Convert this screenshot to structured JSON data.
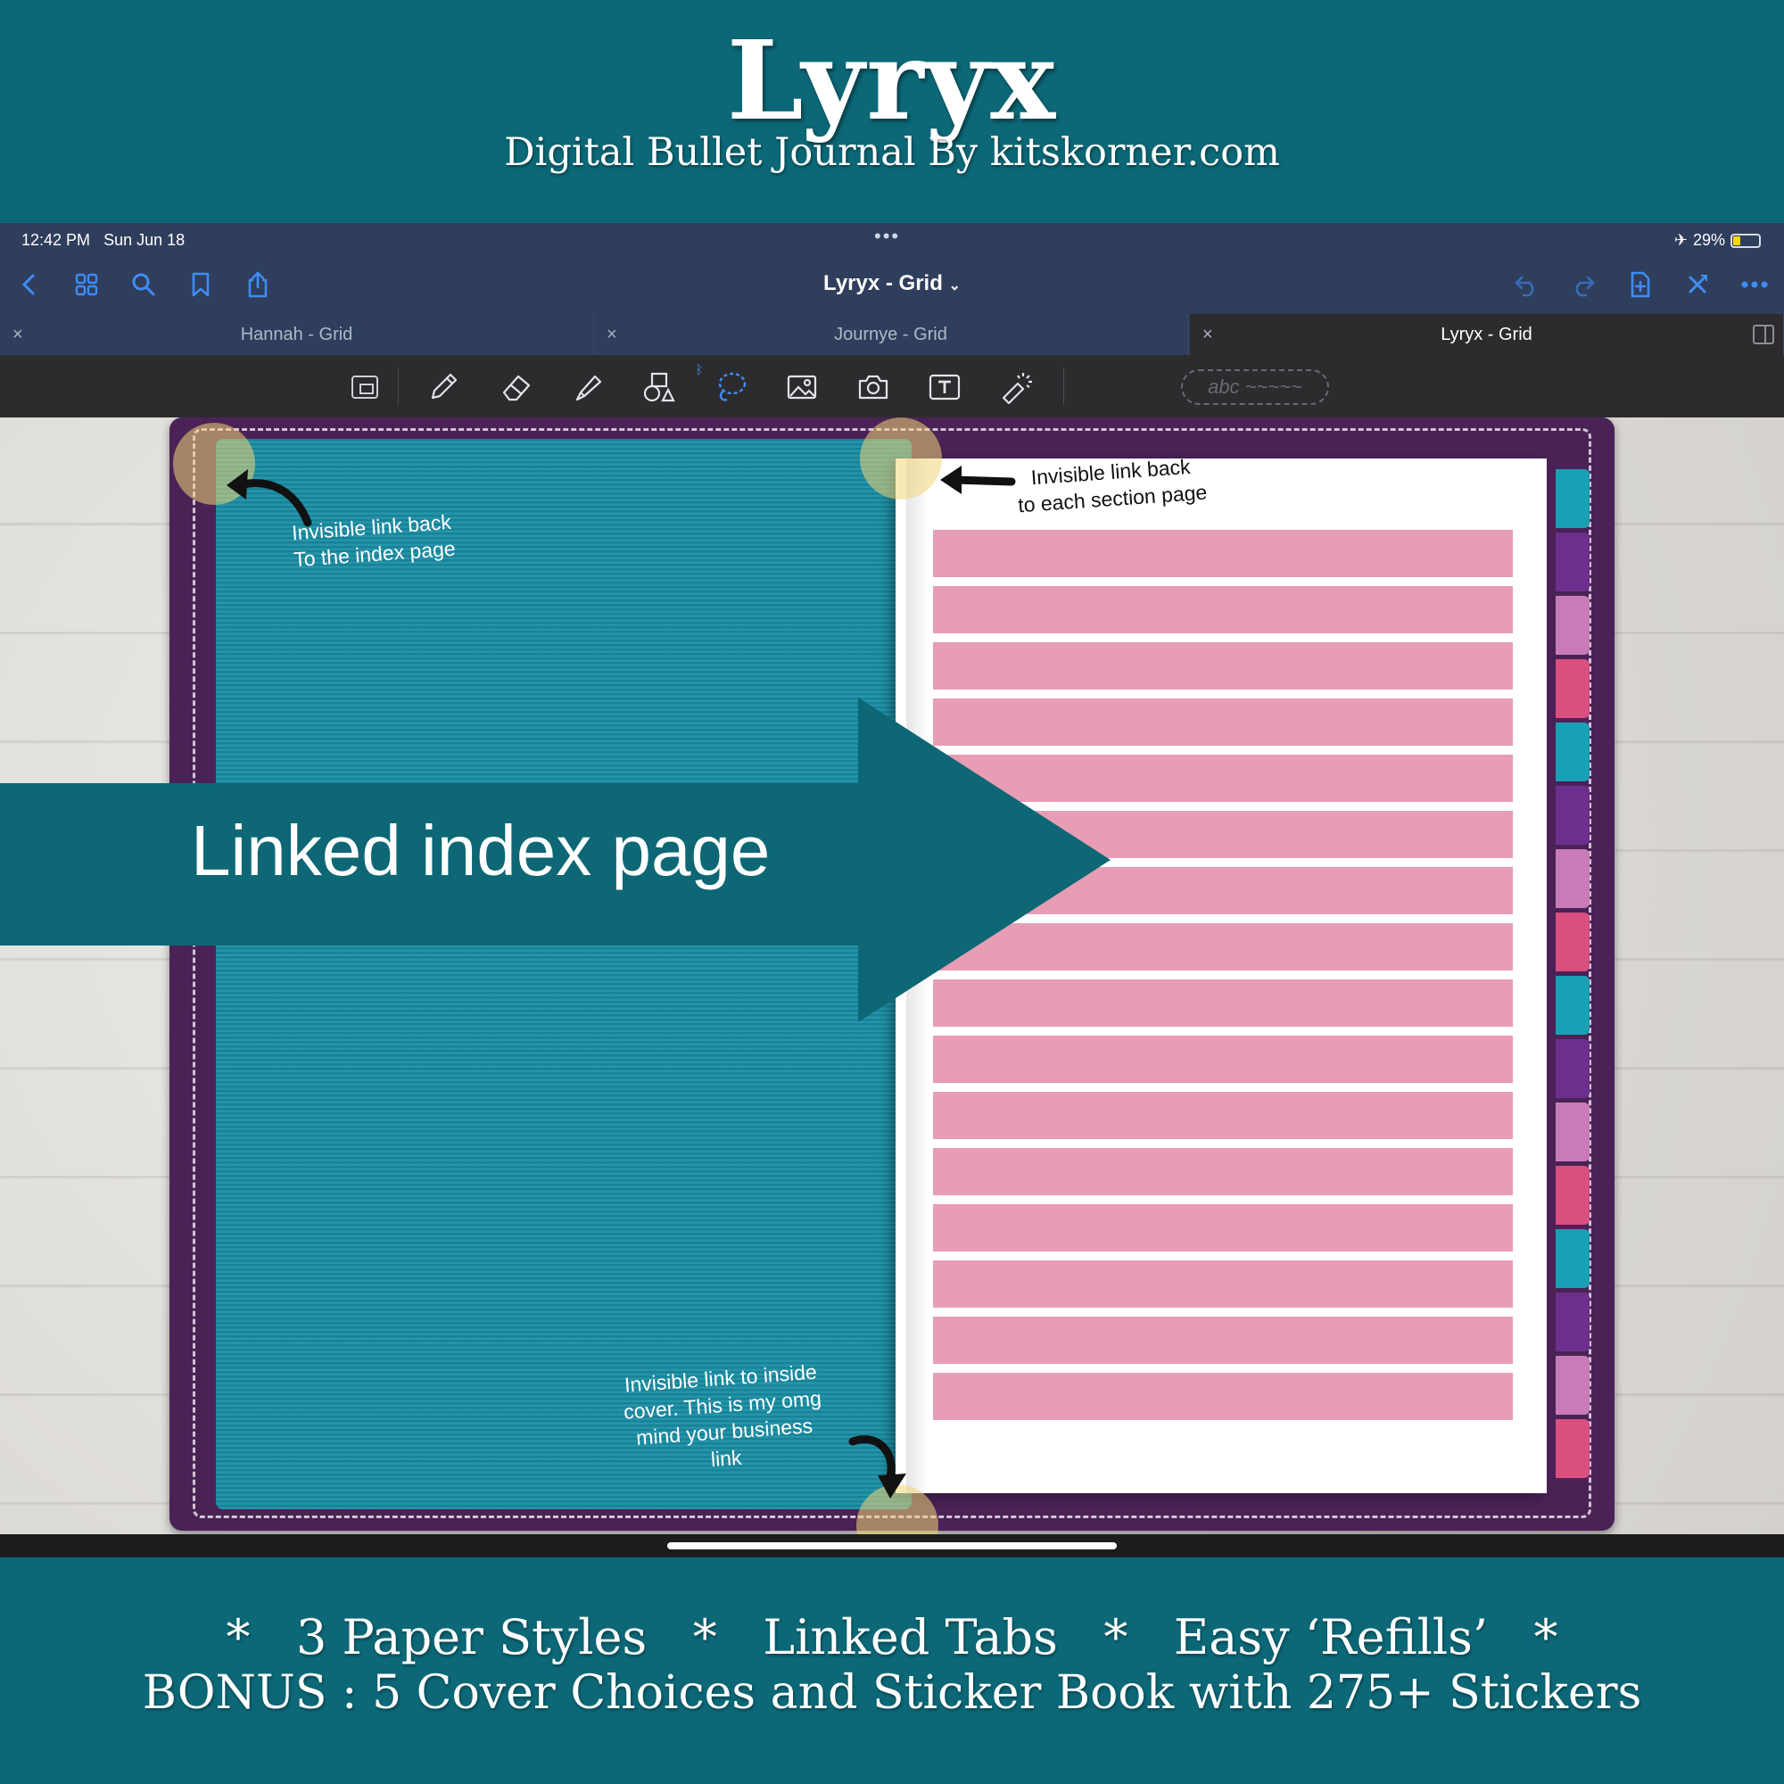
{
  "promo": {
    "title": "Lyryx",
    "subtitle": "Digital Bullet Journal By kitskorner.com",
    "features": "*   3 Paper Styles   *   Linked Tabs   *   Easy ‘Refills’   *",
    "bonus": "BONUS : 5 Cover Choices and Sticker Book with 275+ Stickers"
  },
  "status_bar": {
    "time": "12:42 PM",
    "date": "Sun Jun 18",
    "battery": "29%",
    "battery_level": 0.29,
    "airplane_icon": "airplane-icon"
  },
  "nav": {
    "document_title": "Lyryx - Grid",
    "left_icons": [
      "back-icon",
      "thumbnails-icon",
      "search-icon",
      "bookmark-icon",
      "share-icon"
    ],
    "right_icons": [
      "undo-icon",
      "redo-icon",
      "add-page-icon",
      "close-doc-icon",
      "more-icon"
    ]
  },
  "tabs": [
    {
      "label": "Hannah - Grid",
      "active": false
    },
    {
      "label": "Journye - Grid",
      "active": false
    },
    {
      "label": "Lyryx - Grid",
      "active": true
    }
  ],
  "toolbar": {
    "tools": [
      "zoom-window-icon",
      "pen-icon",
      "eraser-icon",
      "highlighter-icon",
      "shapes-icon",
      "lasso-icon",
      "image-icon",
      "camera-icon",
      "text-box-icon",
      "laser-pointer-icon"
    ],
    "text_recognition_label": "abc ~~~~~",
    "bluetooth_icon": "bluetooth-icon"
  },
  "canvas": {
    "annotations": {
      "index_link": "Invisible link back\nTo the index page",
      "section_link": "Invisible link back\nto each section page",
      "inside_cover_link": "Invisible link to inside\ncover. This is my omg\nmind your business\nlink"
    },
    "callout": "Linked index page",
    "index_rows": 16,
    "tab_colors": [
      "#1aa0b5",
      "#6c2f8e",
      "#c97bb8",
      "#d94f7e",
      "#1aa0b5",
      "#6c2f8e",
      "#c97bb8",
      "#d94f7e",
      "#1aa0b5",
      "#6c2f8e",
      "#c97bb8",
      "#d94f7e",
      "#1aa0b5",
      "#6c2f8e",
      "#c97bb8",
      "#d94f7e"
    ],
    "colors": {
      "binder": "#4a2256",
      "cover": "#1a8fa6",
      "index_row": "#e79db4",
      "callout": "#0d6775",
      "accent": "#3f8cf5"
    }
  }
}
